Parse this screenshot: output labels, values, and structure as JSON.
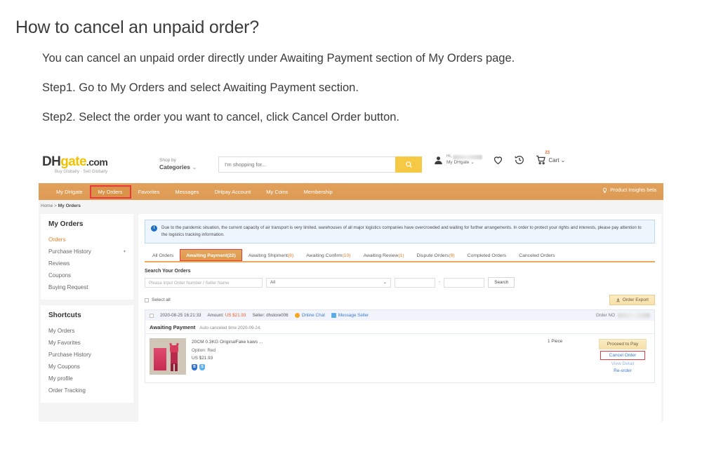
{
  "article": {
    "title": "How to cancel an unpaid order?",
    "paragraphs": [
      "You can cancel an unpaid order directly under Awaiting Payment section of My Orders page.",
      "Step1. Go to My Orders and select Awaiting Payment section.",
      "Step2. Select the order you want to cancel, click Cancel Order button."
    ]
  },
  "screenshot": {
    "header": {
      "logo": {
        "part1": "DH",
        "part2": "gate",
        "part3": ".com",
        "tagline": "Buy Globally · Sell Globally"
      },
      "shop_by": {
        "line1": "Shop by",
        "line2": "Categories"
      },
      "search": {
        "placeholder": "I'm shopping for...",
        "icon": "search-icon"
      },
      "account": {
        "greeting": "Hi,",
        "label": "My DHgate"
      },
      "icons": {
        "wishlist": "heart-icon",
        "history": "history-icon",
        "cart": "cart-icon"
      },
      "cart": {
        "badge": "23",
        "label": "Cart"
      }
    },
    "nav": {
      "items": [
        {
          "label": "My DHgate",
          "active": false
        },
        {
          "label": "My Orders",
          "active": true
        },
        {
          "label": "Favorites",
          "active": false
        },
        {
          "label": "Messages",
          "active": false
        },
        {
          "label": "DHpay Account",
          "active": false
        },
        {
          "label": "My Coins",
          "active": false
        },
        {
          "label": "Membership",
          "active": false
        }
      ],
      "insights": "Product Insights beta"
    },
    "breadcrumb": {
      "home": "Home",
      "sep": ">",
      "current": "My Orders"
    },
    "sidebar": {
      "title": "My Orders",
      "items": [
        {
          "label": "Orders",
          "selected": true
        },
        {
          "label": "Purchase History",
          "selected": false,
          "arrow": "▾"
        },
        {
          "label": "Reviews",
          "selected": false
        },
        {
          "label": "Coupons",
          "selected": false
        },
        {
          "label": "Buying Request",
          "selected": false
        }
      ],
      "shortcuts_title": "Shortcuts",
      "shortcuts": [
        {
          "label": "My Orders"
        },
        {
          "label": "My Favorites"
        },
        {
          "label": "Purchase History"
        },
        {
          "label": "My Coupons"
        },
        {
          "label": "My profile"
        },
        {
          "label": "Order Tracking"
        }
      ]
    },
    "notice": {
      "icon": "info-icon",
      "text": "Due to the pandemic situation, the current capacity of air transport is very limited, warehouses of all major logistics companies have overcrowded and waiting for further arrangements. In order to protect your rights and interests, please pay attention to the logistics tracking information."
    },
    "tabs": [
      {
        "label": "All Orders",
        "count": "",
        "active": false
      },
      {
        "label": "Awaiting Payment",
        "count": "(22)",
        "active": true
      },
      {
        "label": "Awaiting Shipment",
        "count": "(8)",
        "active": false
      },
      {
        "label": "Awaiting Confirm",
        "count": "(10)",
        "active": false
      },
      {
        "label": "Awaiting Review",
        "count": "(1)",
        "active": false
      },
      {
        "label": "Dispute Orders",
        "count": "(9)",
        "active": false
      },
      {
        "label": "Completed Orders",
        "count": "",
        "active": false
      },
      {
        "label": "Canceled Orders",
        "count": "",
        "active": false
      }
    ],
    "search_orders": {
      "label": "Search Your Orders",
      "placeholder": "Please input Order Number / Seller Name",
      "select_value": "All",
      "date_sep": "-",
      "button": "Search"
    },
    "list_toolbar": {
      "select_all": "Select all",
      "export_button": "Order Export",
      "export_icon": "download-icon"
    },
    "order": {
      "date": "2020-08-25 16:21:33",
      "amount_label": "Amount:",
      "amount_value": "US $21.93",
      "seller_label": "Seller:",
      "seller_value": "dhstore006",
      "online_chat": "Online Chat",
      "message_seller": "Message Seller",
      "order_no_label": "Order NO",
      "status_title": "Awaiting Payment",
      "auto_cancel": "Auto canceled time 2020-09-24.",
      "item": {
        "name": "20CM 0.3KG OriginalFake kaws ...",
        "option": "Option: Red",
        "price": "US $21.93",
        "qty": "1 Piece",
        "badges": [
          "buyer-protection-icon",
          "shield-icon"
        ]
      },
      "actions": {
        "pay": "Proceed to Pay",
        "cancel": "Cancel Order",
        "detail": "View Detail",
        "reorder": "Re-order"
      }
    }
  },
  "colors": {
    "brand_orange": "#e2a15b",
    "highlight_red": "#e8393b",
    "accent_yellow": "#f5c944",
    "link_blue": "#3a7bd0",
    "price_orange": "#ee5a22"
  }
}
